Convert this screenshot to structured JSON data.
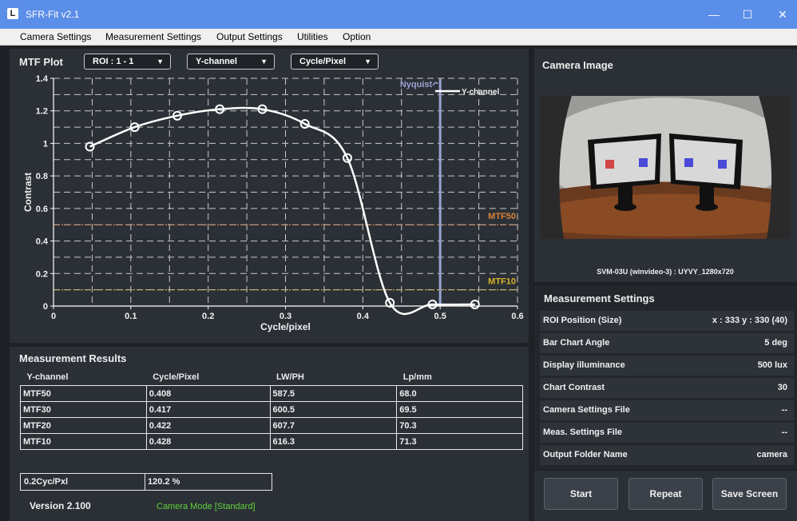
{
  "window": {
    "logo": "L",
    "title": "SFR-Fit v2.1",
    "minimize": "—",
    "maximize": "☐",
    "close": "✕"
  },
  "menu": [
    "Camera Settings",
    "Measurement Settings",
    "Output Settings",
    "Utilities",
    "Option"
  ],
  "mtf_plot": {
    "header": "MTF Plot",
    "roi_select": "ROI : 1 - 1",
    "channel_select": "Y-channel",
    "unit_select": "Cycle/Pixel",
    "dropdown_arrow": "▼"
  },
  "chart_data": {
    "type": "line",
    "xlabel": "Cycle/pixel",
    "ylabel": "Contrast",
    "xlim": [
      0,
      0.6
    ],
    "ylim": [
      0,
      1.4
    ],
    "x_ticks": [
      "0",
      "0.1",
      "0.2",
      "0.3",
      "0.4",
      "0.5",
      "0.6"
    ],
    "y_ticks": [
      "0",
      "0.2",
      "0.4",
      "0.6",
      "0.8",
      "1",
      "1.2",
      "1.4"
    ],
    "grid": true,
    "legend_position": "top-right",
    "series": [
      {
        "name": "Y-channel",
        "color": "#ffffff",
        "x": [
          0.047,
          0.105,
          0.16,
          0.215,
          0.27,
          0.325,
          0.38,
          0.435,
          0.49,
          0.545
        ],
        "y": [
          0.98,
          1.1,
          1.17,
          1.21,
          1.21,
          1.12,
          0.91,
          0.02,
          0.01,
          0.01
        ]
      }
    ],
    "reference_lines": [
      {
        "label": "MTF50",
        "y": 0.5,
        "color": "#d9823b"
      },
      {
        "label": "MTF10",
        "y": 0.1,
        "color": "#d6b427"
      }
    ],
    "nyquist": {
      "label": "Nyquist",
      "x": 0.5,
      "color": "#9aa3d0"
    }
  },
  "camera": {
    "header": "Camera Image",
    "caption": "SVM-03U (winvideo-3) : UYVY_1280x720"
  },
  "measurement_settings": {
    "header": "Measurement Settings",
    "rows": [
      {
        "label": "ROI Position (Size)",
        "value": "x : 333    y : 330    (40)"
      },
      {
        "label": "Bar Chart Angle",
        "value": "5 deg"
      },
      {
        "label": "Display illuminance",
        "value": "500 lux"
      },
      {
        "label": "Chart Contrast",
        "value": "30"
      },
      {
        "label": "Camera Settings File",
        "value": "--"
      },
      {
        "label": "Meas. Settings File",
        "value": "--"
      },
      {
        "label": "Output Folder Name",
        "value": "camera"
      }
    ]
  },
  "results": {
    "header": "Measurement Results",
    "columns": [
      "Y-channel",
      "Cycle/Pixel",
      "LW/PH",
      "Lp/mm"
    ],
    "rows": [
      [
        "MTF50",
        "0.408",
        "587.5",
        "68.0"
      ],
      [
        "MTF30",
        "0.417",
        "600.5",
        "69.5"
      ],
      [
        "MTF20",
        "0.422",
        "607.7",
        "70.3"
      ],
      [
        "MTF10",
        "0.428",
        "616.3",
        "71.3"
      ]
    ],
    "cycle_label": "0.2Cyc/Pxl",
    "cycle_value": "120.2 %"
  },
  "footer": {
    "version": "Version 2.100",
    "mode": "Camera Mode [Standard]"
  },
  "buttons": {
    "start": "Start",
    "repeat": "Repeat",
    "save": "Save Screen"
  }
}
